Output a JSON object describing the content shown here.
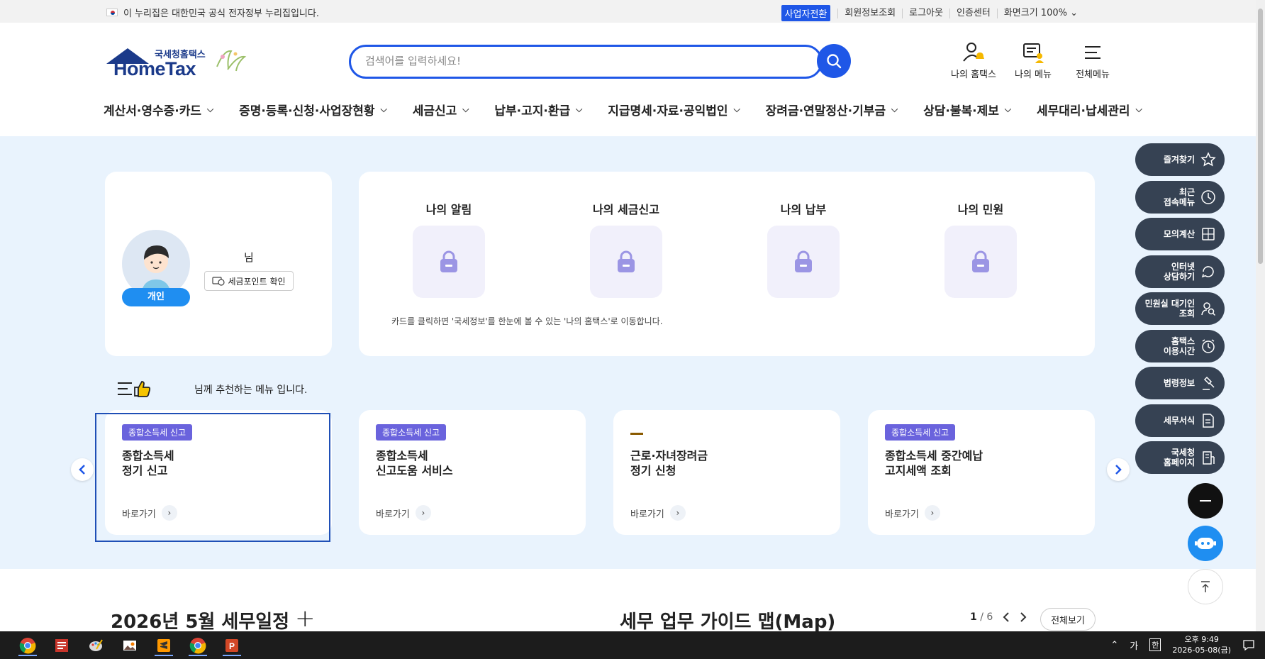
{
  "gov_banner": {
    "text": "이 누리집은 대한민국 공식 전자정부 누리집입니다.",
    "business_switch": "사업자전환",
    "links": [
      "회원정보조회",
      "로그아웃",
      "인증센터",
      "화면크기 100% ⌄"
    ]
  },
  "logo": {
    "sub": "국세청홈택스",
    "main": "HomeTax"
  },
  "search": {
    "placeholder": "검색어를 입력하세요!"
  },
  "top_menu": {
    "my_hometax": "나의 홈택스",
    "my_menu": "나의 메뉴",
    "all_menu": "전체메뉴"
  },
  "gnb": [
    "계산서·영수증·카드",
    "증명·등록·신청·사업장현황",
    "세금신고",
    "납부·고지·환급",
    "지급명세·자료·공익법인",
    "장려금·연말정산·기부금",
    "상담·불복·제보",
    "세무대리·납세관리"
  ],
  "profile": {
    "nim": "님",
    "point_button": "세금포인트 확인",
    "badge": "개인"
  },
  "my_cards": {
    "items": [
      "나의 알림",
      "나의 세금신고",
      "나의 납부",
      "나의 민원"
    ],
    "note": "카드를 클릭하면 '국세정보'를 한눈에 볼 수 있는 '나의 홈택스'로 이동합니다."
  },
  "recommend": {
    "heading": "님께 추천하는 메뉴 입니다.",
    "go_label": "바로가기",
    "cards": [
      {
        "tag": "종합소득세 신고",
        "line1": "종합소득세",
        "line2": "정기 신고"
      },
      {
        "tag": "종합소득세 신고",
        "line1": "종합소득세",
        "line2": "신고도움 서비스"
      },
      {
        "tag": "",
        "line1": "근로·자녀장려금",
        "line2": "정기 신청"
      },
      {
        "tag": "종합소득세 신고",
        "line1": "종합소득세 중간예납",
        "line2": "고지세액 조회"
      }
    ]
  },
  "quick_menu": [
    {
      "line1": "즐겨찾기",
      "line2": "",
      "icon": "star-icon"
    },
    {
      "line1": "최근",
      "line2": "접속메뉴",
      "icon": "clock-icon"
    },
    {
      "line1": "모의계산",
      "line2": "",
      "icon": "calculator-icon"
    },
    {
      "line1": "인터넷",
      "line2": "상담하기",
      "icon": "chat-icon"
    },
    {
      "line1": "민원실 대기인",
      "line2": "조회",
      "icon": "people-search-icon"
    },
    {
      "line1": "홈택스",
      "line2": "이용시간",
      "icon": "alarm-icon"
    },
    {
      "line1": "법령정보",
      "line2": "",
      "icon": "gavel-icon"
    },
    {
      "line1": "세무서식",
      "line2": "",
      "icon": "document-icon"
    },
    {
      "line1": "국세청",
      "line2": "홈페이지",
      "icon": "building-icon"
    }
  ],
  "bottom": {
    "schedule_title": "2026년 5월 세무일정",
    "guide_title": "세무 업무 가이드 맵(Map)",
    "page_current": "1",
    "page_total": "/ 6",
    "view_all": "전체보기"
  },
  "taskbar": {
    "ime1": "가",
    "ime2": "한",
    "time": "오후 9:49",
    "date": "2026-05-08(금)"
  },
  "colors": {
    "primary": "#1f57e7",
    "main_bg": "#e9f3fd",
    "tag": "#6a63dd",
    "quick_btn": "#364253",
    "lock_bg": "#f1f0fb",
    "lock_icon": "#9b95e4"
  }
}
